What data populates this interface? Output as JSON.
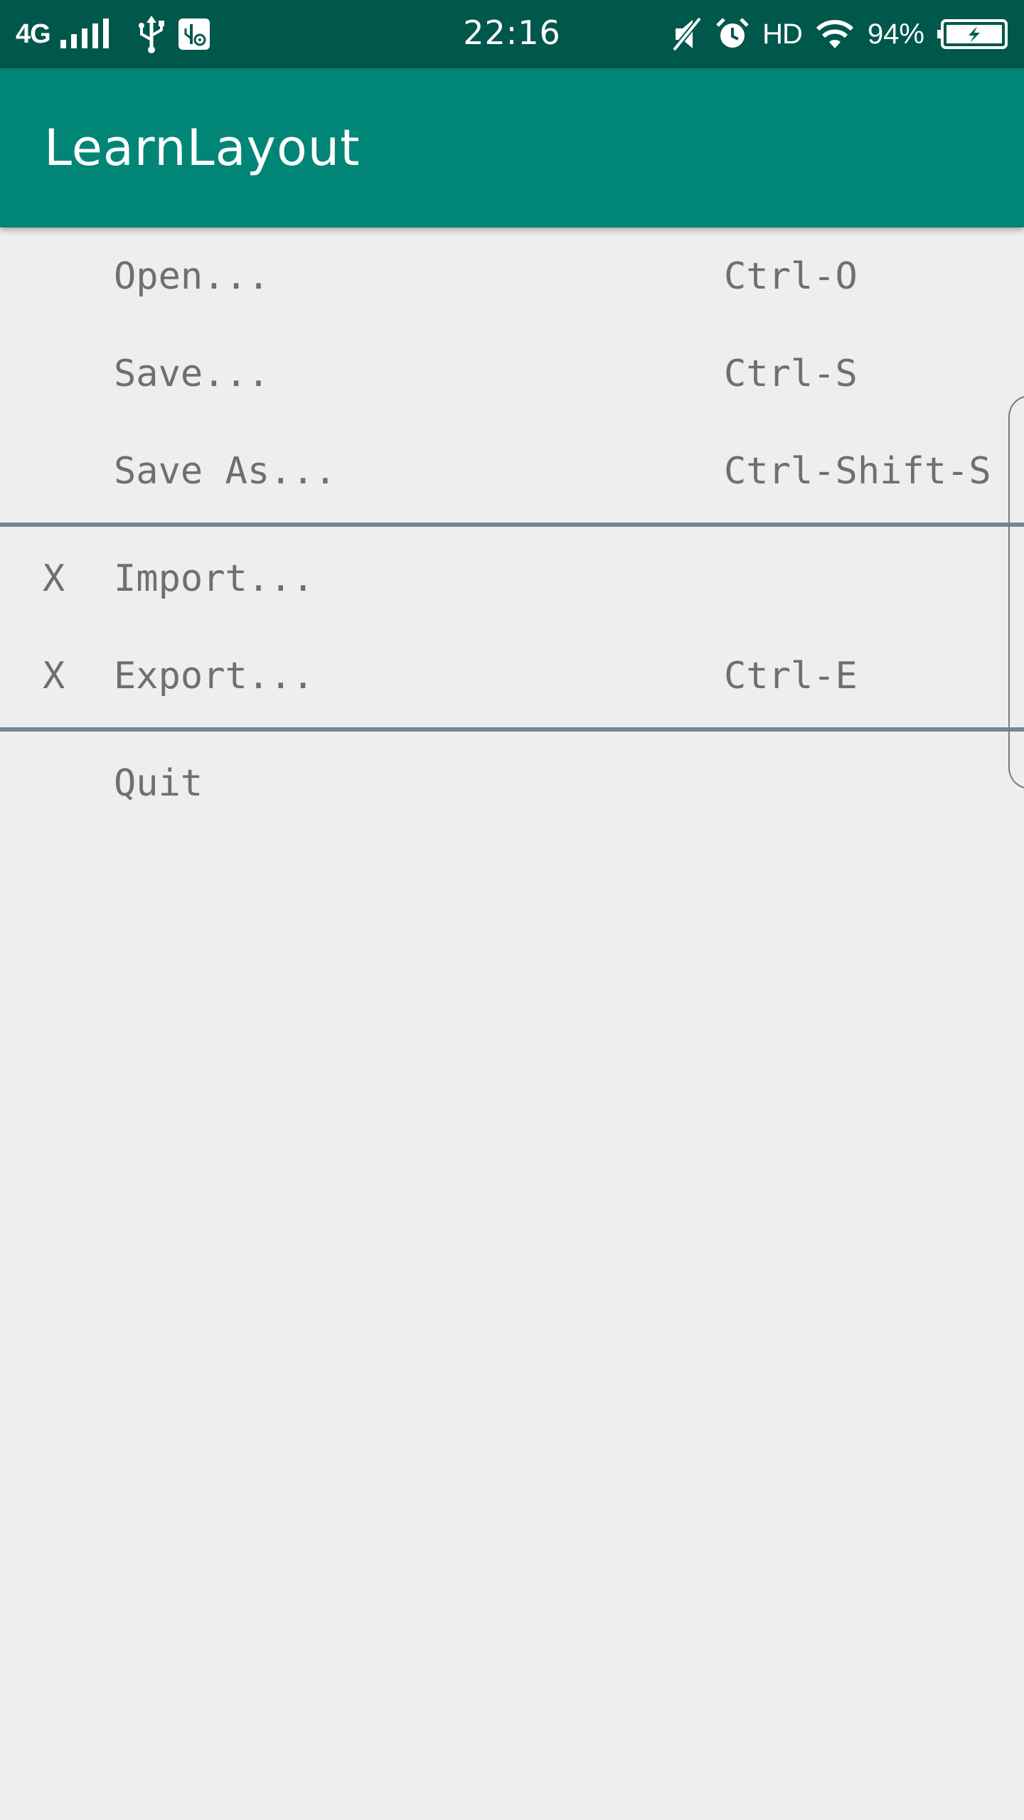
{
  "status_bar": {
    "network": "4G",
    "time": "22:16",
    "hd": "HD",
    "battery": "94%",
    "icons": [
      "signal-icon",
      "usb-icon",
      "usb-debug-icon",
      "mute-icon",
      "alarm-icon",
      "wifi-icon",
      "battery-charging-icon"
    ]
  },
  "app_bar": {
    "title": "LearnLayout",
    "color": "#008577"
  },
  "menu": {
    "open": {
      "check": "",
      "label": "Open...",
      "shortcut": "Ctrl-O"
    },
    "save": {
      "check": "",
      "label": "Save...",
      "shortcut": "Ctrl-S"
    },
    "save_as": {
      "check": "",
      "label": "Save As...",
      "shortcut": "Ctrl-Shift-S"
    },
    "import": {
      "check": "X",
      "label": "Import...",
      "shortcut": ""
    },
    "export": {
      "check": "X",
      "label": "Export...",
      "shortcut": "Ctrl-E"
    },
    "quit": {
      "check": "",
      "label": "Quit",
      "shortcut": ""
    }
  },
  "colors": {
    "status_bar": "#00574b",
    "background": "#eeeeef",
    "text": "#6f6f6f",
    "divider": "#77858f"
  }
}
